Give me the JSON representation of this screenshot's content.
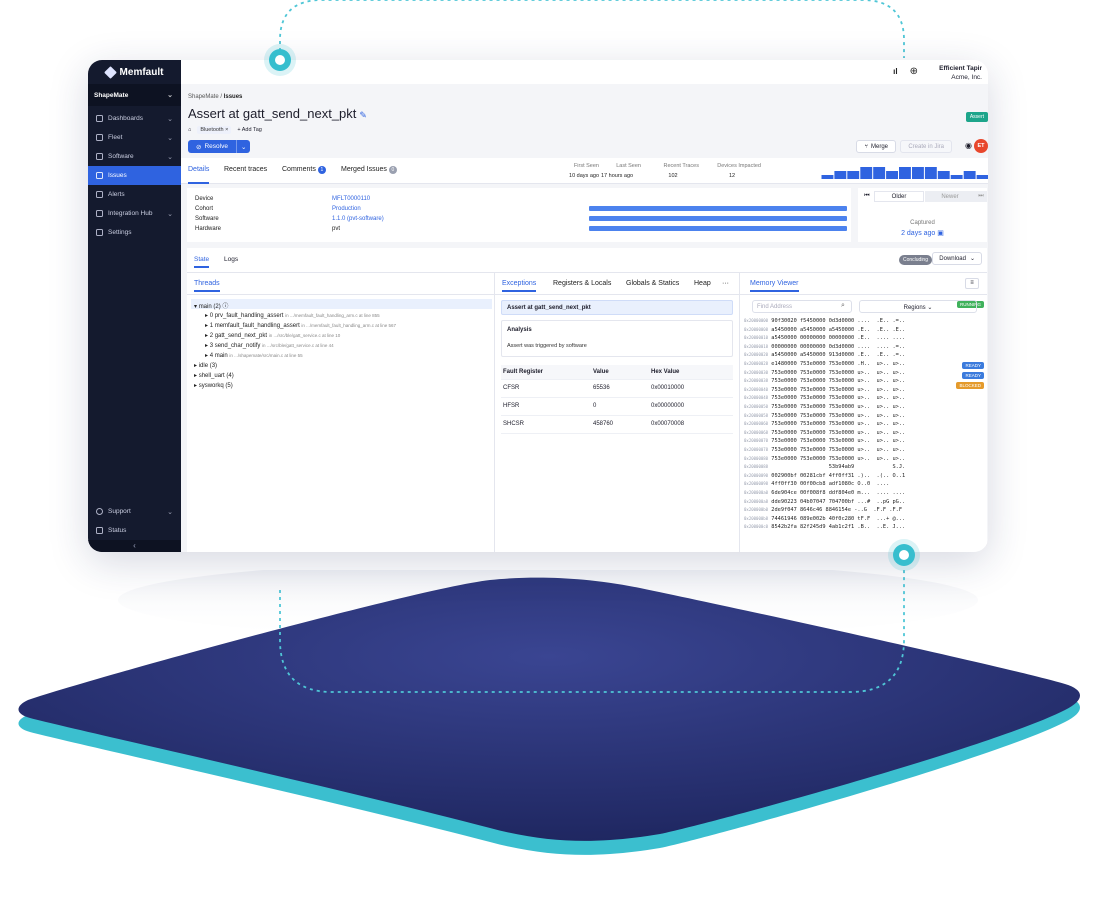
{
  "sidebar": {
    "brand": "Memfault",
    "project": "ShapeMate",
    "items": [
      {
        "label": "Dashboards",
        "chevron": true
      },
      {
        "label": "Fleet",
        "chevron": true
      },
      {
        "label": "Software",
        "chevron": true
      },
      {
        "label": "Issues",
        "chevron": false
      },
      {
        "label": "Alerts",
        "chevron": false
      },
      {
        "label": "Integration Hub",
        "chevron": true
      },
      {
        "label": "Settings",
        "chevron": false
      }
    ],
    "support": "Support",
    "status": "Status",
    "collapse_icon": "chevron-left-icon"
  },
  "topbar": {
    "user_name": "Efficient Tapir",
    "org": "Acme, Inc."
  },
  "breadcrumb": {
    "project": "ShapeMate",
    "sep": "/",
    "page": "Issues"
  },
  "issue": {
    "title": "Assert at gatt_send_next_pkt",
    "badge": "Assert",
    "tag": "Bluetooth",
    "add_tag": "+ Add Tag",
    "resolve": "Resolve",
    "merge": "Merge",
    "create_jira": "Create in Jira",
    "avatar": "ET"
  },
  "tabs": [
    {
      "label": "Details",
      "active": true
    },
    {
      "label": "Recent traces"
    },
    {
      "label": "Comments",
      "count": "1"
    },
    {
      "label": "Merged Issues",
      "count": "0"
    }
  ],
  "stats": {
    "first_seen": {
      "label": "First Seen",
      "value": "10 days ago"
    },
    "last_seen": {
      "label": "Last Seen",
      "value": "17 hours ago"
    },
    "recent_traces": {
      "label": "Recent Traces",
      "value": "102"
    },
    "devices_impacted": {
      "label": "Devices Impacted",
      "value": "12"
    }
  },
  "histogram_values": [
    1,
    2,
    2,
    3,
    3,
    2,
    3,
    3,
    3,
    2,
    1,
    2,
    1
  ],
  "details": {
    "device_label": "Device",
    "device": "MFLT0000110",
    "cohort_label": "Cohort",
    "cohort": "Production",
    "software_label": "Software",
    "software": "1.1.0 (pvt-software)",
    "hardware_label": "Hardware",
    "hardware": "pvt"
  },
  "trace_nav": {
    "older": "Older",
    "newer": "Newer",
    "captured_label": "Captured",
    "captured": "2 days ago"
  },
  "state_tabs": {
    "state": "State",
    "logs": "Logs",
    "badge": "Concluding",
    "download": "Download"
  },
  "threads": {
    "title": "Threads",
    "main": {
      "label": "main (2)",
      "state": "RUNNING"
    },
    "frames": [
      {
        "label": "0 prv_fault_handling_assert",
        "file": "in .../memfault_fault_handling_arm.c at line 855"
      },
      {
        "label": "1 memfault_fault_handling_assert",
        "file": "in .../memfault_fault_handling_arm.c at line 567"
      },
      {
        "label": "2 gatt_send_next_pkt",
        "file": "in .../src/ble/gatt_service.c at line 10"
      },
      {
        "label": "3 send_char_notify",
        "file": "in .../src/ble/gatt_service.c at line 44"
      },
      {
        "label": "4 main",
        "file": "in .../shapemate/src/main.c at line 55"
      }
    ],
    "others": [
      {
        "label": "idle (3)",
        "state": "READY"
      },
      {
        "label": "shell_uart (4)",
        "state": "READY"
      },
      {
        "label": "sysworkq (5)",
        "state": "BLOCKED"
      }
    ]
  },
  "exceptions": {
    "tabs": [
      "Exceptions",
      "Registers & Locals",
      "Globals & Statics",
      "Heap",
      "···"
    ],
    "heading": "Assert at gatt_send_next_pkt",
    "analysis_title": "Analysis",
    "analysis_text": "Assert was triggered by software",
    "table_headers": [
      "Fault Register",
      "Value",
      "Hex Value"
    ],
    "rows": [
      [
        "CFSR",
        "65536",
        "0x00010000"
      ],
      [
        "HFSR",
        "0",
        "0x00000000"
      ],
      [
        "SHCSR",
        "458760",
        "0x00070008"
      ]
    ]
  },
  "memory": {
    "title": "Memory Viewer",
    "find_placeholder": "Find Address",
    "regions": "Regions",
    "rows": [
      {
        "addr": "0x20000000",
        "data": "90f30020 f5450000 0d3d0000 ....  .E.. .=.."
      },
      {
        "addr": "0x20000008",
        "data": "a5450000 a5450000 a5450000 .E..  .E.. .E.."
      },
      {
        "addr": "0x20000010",
        "data": "a5450000 00000000 00000000 .E..  .... ...."
      },
      {
        "addr": "0x20000018",
        "data": "00000000 00000000 0d3d0000 ....  .... .=.."
      },
      {
        "addr": "0x20000020",
        "data": "a5450000 a5450000 913d0000 .E..  .E.. .=.."
      },
      {
        "addr": "0x20000028",
        "data": "e1480000 753e0000 753e0000 .H..  u>.. u>.."
      },
      {
        "addr": "0x20000030",
        "data": "753e0000 753e0000 753e0000 u>..  u>.. u>.."
      },
      {
        "addr": "0x20000038",
        "data": "753e0000 753e0000 753e0000 u>..  u>.. u>.."
      },
      {
        "addr": "0x20000040",
        "data": "753e0000 753e0000 753e0000 u>..  u>.. u>.."
      },
      {
        "addr": "0x20000048",
        "data": "753e0000 753e0000 753e0000 u>..  u>.. u>.."
      },
      {
        "addr": "0x20000050",
        "data": "753e0000 753e0000 753e0000 u>..  u>.. u>.."
      },
      {
        "addr": "0x20000058",
        "data": "753e0000 753e0000 753e0000 u>..  u>.. u>.."
      },
      {
        "addr": "0x20000060",
        "data": "753e0000 753e0000 753e0000 u>..  u>.. u>.."
      },
      {
        "addr": "0x20000068",
        "data": "753e0000 753e0000 753e0000 u>..  u>.. u>.."
      },
      {
        "addr": "0x20000070",
        "data": "753e0000 753e0000 753e0000 u>..  u>.. u>.."
      },
      {
        "addr": "0x20000078",
        "data": "753e0000 753e0000 753e0000 u>..  u>.. u>.."
      },
      {
        "addr": "0x20000080",
        "data": "753e0000 753e0000 753e0000 u>..  u>.. u>.."
      },
      {
        "addr": "0x20000088",
        "data": "                  53b94ab9            S.J."
      },
      {
        "addr": "0x20000090",
        "data": "002900bf 00281cbf 4ff0ff31 .)..  .(.. O..1"
      },
      {
        "addr": "0x20000098",
        "data": "4ff0ff30 00f00cb8 adf1080c O..0  ...."
      },
      {
        "addr": "0x200000a0",
        "data": "6de904ce 00f008f8 ddf804e0 m...  .... ...."
      },
      {
        "addr": "0x200000a8",
        "data": "dde90223 04b07047 704700bf ...#  ..pG pG.."
      },
      {
        "addr": "0x200000b0",
        "data": "2de9f047 8646c46 8846154e -..G  .F.F .F.F"
      },
      {
        "addr": "0x200000b8",
        "data": "74461946 089e002b 40f0c280 tF.F  ...+ @..."
      },
      {
        "addr": "0x200000c0",
        "data": "8542b2fa 82f245d9 4ab1c2f1 .B..  ..E. J..."
      }
    ]
  },
  "colors": {
    "accent": "#2f63e0",
    "sidebar": "#141a2e",
    "teal": "#36bece",
    "platform": "#2a3475"
  }
}
